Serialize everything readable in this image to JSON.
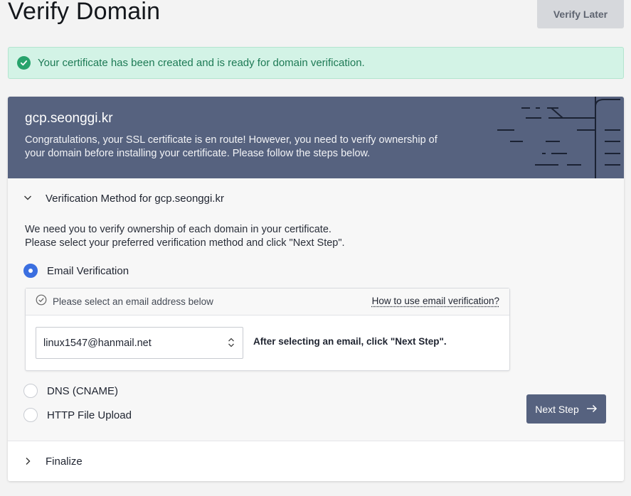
{
  "page": {
    "title": "Verify Domain",
    "verify_later_label": "Verify Later"
  },
  "alert": {
    "message": "Your certificate has been created and is ready for domain verification.",
    "color": "#27a36c"
  },
  "banner": {
    "domain": "gcp.seonggi.kr",
    "message": "Congratulations, your SSL certificate is en route! However, you need to verify ownership of your domain before installing your certificate. Please follow the steps below.",
    "background": "#56627f"
  },
  "verification": {
    "header": "Verification Method for gcp.seonggi.kr",
    "instruction_line1": "We need you to verify ownership of each domain in your certificate.",
    "instruction_line2": "Please select your preferred verification method and click \"Next Step\".",
    "methods": [
      {
        "label": "Email Verification",
        "selected": true
      },
      {
        "label": "DNS (CNAME)",
        "selected": false
      },
      {
        "label": "HTTP File Upload",
        "selected": false
      }
    ],
    "email_panel": {
      "hint": "Please select an email address below",
      "help_link": "How to use email verification?",
      "selected_email": "linux1547@hanmail.net",
      "after_text": "After selecting an email, click \"Next Step\"."
    },
    "next_step_label": "Next Step"
  },
  "finalize": {
    "label": "Finalize"
  },
  "colors": {
    "accent": "#3b6fe0",
    "primary_button": "#56627f"
  }
}
